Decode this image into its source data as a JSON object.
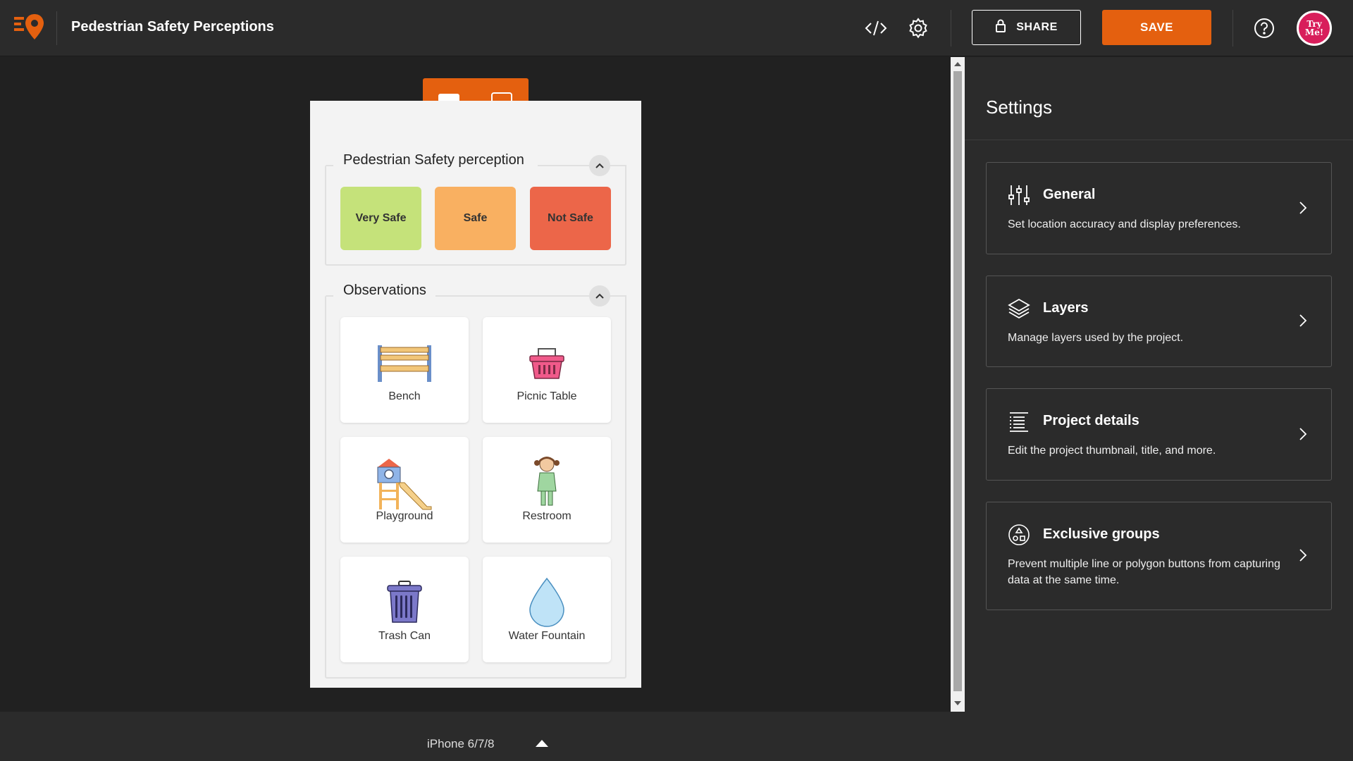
{
  "topbar": {
    "title": "Pedestrian Safety Perceptions",
    "share_label": "SHARE",
    "save_label": "SAVE",
    "avatar_line1": "Try",
    "avatar_line2": "Me!"
  },
  "preview": {
    "device_label": "iPhone 6/7/8",
    "groups": [
      {
        "title": "Pedestrian Safety perception",
        "choices": [
          {
            "label": "Very Safe",
            "color": "#c5e27a"
          },
          {
            "label": "Safe",
            "color": "#f9b061"
          },
          {
            "label": "Not Safe",
            "color": "#ec6649"
          }
        ]
      },
      {
        "title": "Observations",
        "tiles": [
          {
            "label": "Bench",
            "icon": "bench-icon"
          },
          {
            "label": "Picnic Table",
            "icon": "basket-icon"
          },
          {
            "label": "Playground",
            "icon": "playground-icon"
          },
          {
            "label": "Restroom",
            "icon": "restroom-icon"
          },
          {
            "label": "Trash Can",
            "icon": "trash-can-icon"
          },
          {
            "label": "Water Fountain",
            "icon": "water-drop-icon"
          }
        ]
      }
    ]
  },
  "settings": {
    "title": "Settings",
    "cards": [
      {
        "title": "General",
        "description": "Set location accuracy and display preferences.",
        "icon": "sliders-icon"
      },
      {
        "title": "Layers",
        "description": "Manage layers used by the project.",
        "icon": "layers-icon"
      },
      {
        "title": "Project details",
        "description": "Edit the project thumbnail, title, and more.",
        "icon": "details-list-icon"
      },
      {
        "title": "Exclusive groups",
        "description": "Prevent multiple line or polygon buttons from capturing data at the same time.",
        "icon": "shapes-icon"
      }
    ]
  },
  "colors": {
    "accent": "#e4600f",
    "panel": "#2b2b2b",
    "canvas": "#212121"
  }
}
